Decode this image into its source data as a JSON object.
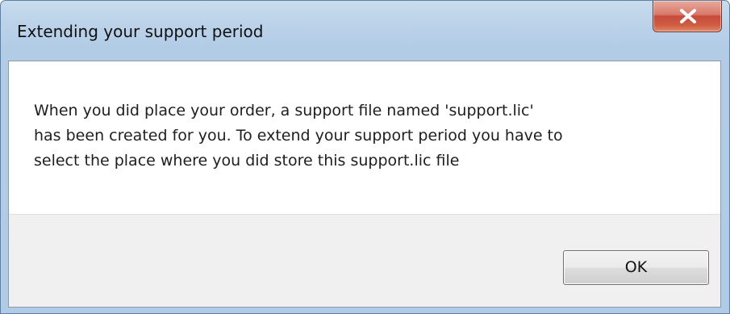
{
  "dialog": {
    "title": "Extending your support period",
    "close_icon": "close-icon",
    "message_lines": [
      "When you did place your order, a support file named 'support.lic'",
      "has been created for you. To extend your support period you have to",
      "select the place where you did store this support.lic file"
    ],
    "ok_label": "OK"
  },
  "colors": {
    "titlebar": "#b7cfe8",
    "close_button": "#c74b3c",
    "footer": "#f0f0f0",
    "content": "#ffffff"
  }
}
